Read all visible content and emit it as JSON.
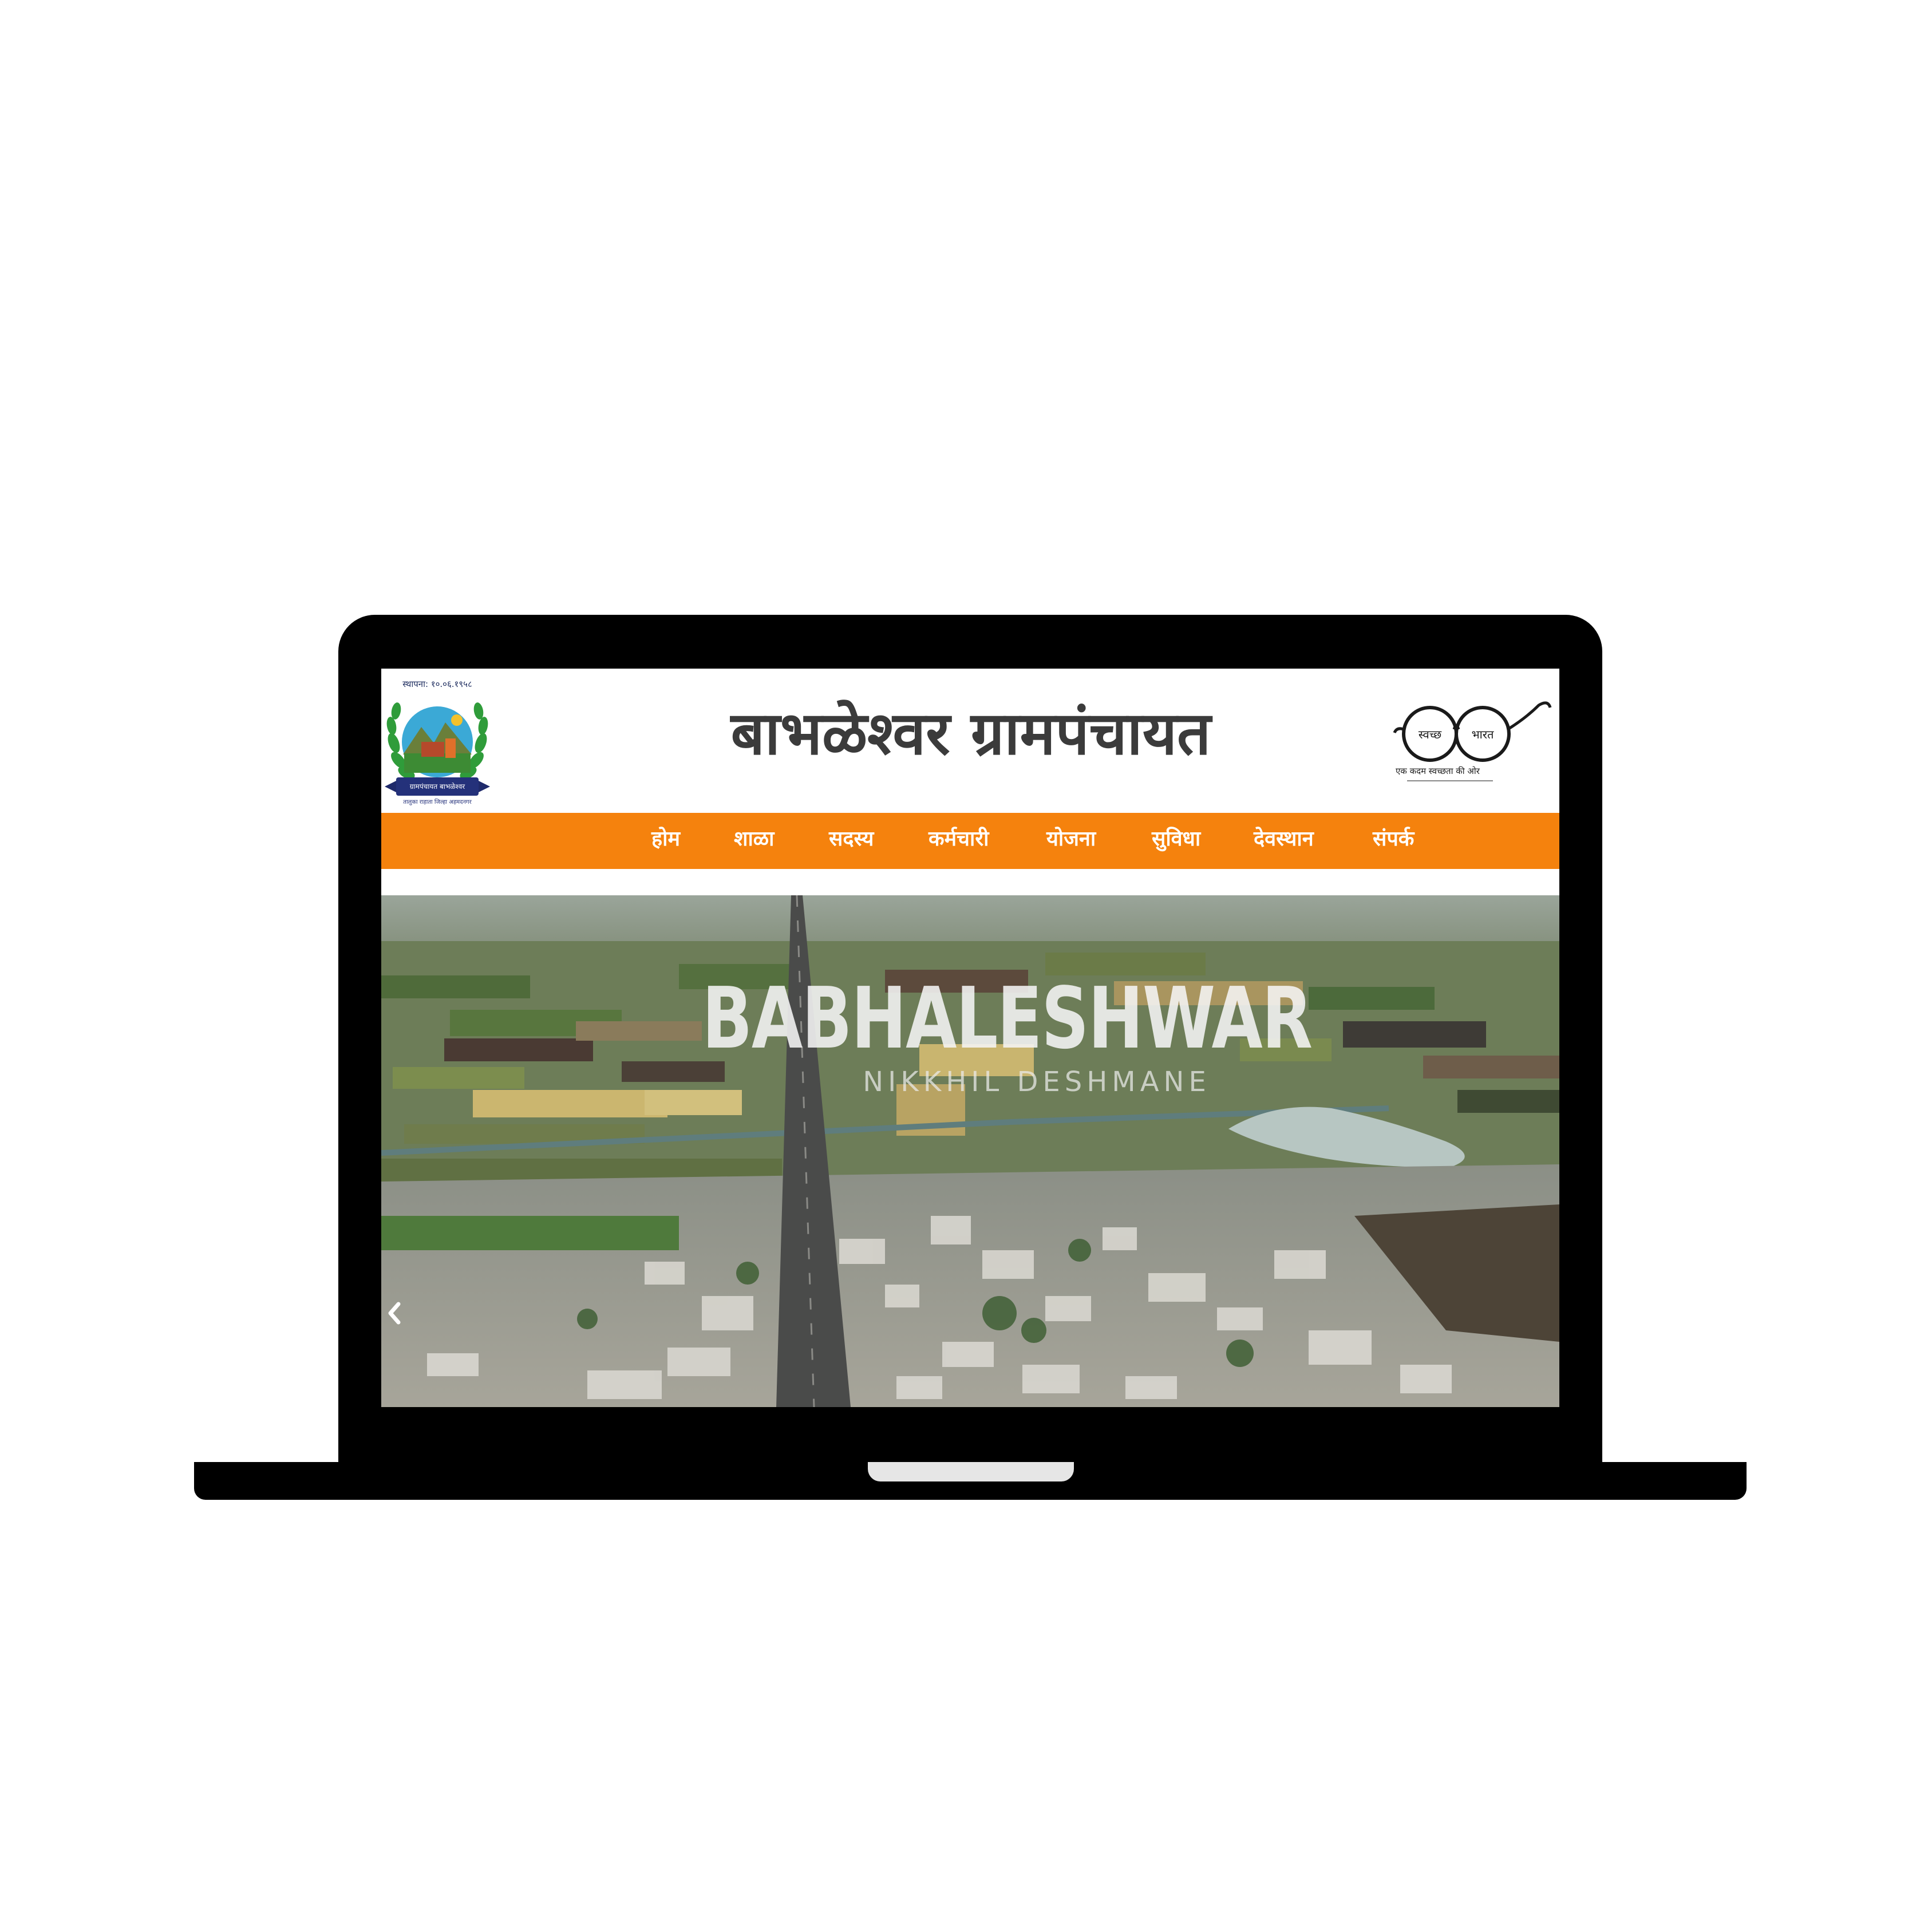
{
  "header": {
    "title": "बाभळेश्वर ग्रामपंचायत",
    "logo_left": {
      "icon": "gram-panchayat-seal-logo",
      "caption_top": "स्थापना: १०.०६.१९५८",
      "ribbon_text": "ग्रामपंचायत बाभळेश्वर",
      "ribbon_sub": "तालुका राहाता जिल्हा अहमदनगर"
    },
    "logo_right": {
      "icon": "swachh-bharat-glasses-logo",
      "left_lens": "स्वच्छ",
      "right_lens": "भारत",
      "tagline": "एक कदम स्वच्छता की ओर"
    }
  },
  "nav": {
    "items": [
      {
        "label": "होम"
      },
      {
        "label": "शाळा"
      },
      {
        "label": "सदस्य"
      },
      {
        "label": "कर्मचारी"
      },
      {
        "label": "योजना"
      },
      {
        "label": "सुविधा"
      },
      {
        "label": "देवस्थान"
      },
      {
        "label": "संपर्क"
      }
    ],
    "background_color": "#f5820d"
  },
  "hero": {
    "title": "BABHALESHWAR",
    "subtitle": "NIKKHIL DESHMANE",
    "image_subject": "aerial view of village with highway, farm fields and lake",
    "prev_icon": "chevron-left-icon"
  }
}
